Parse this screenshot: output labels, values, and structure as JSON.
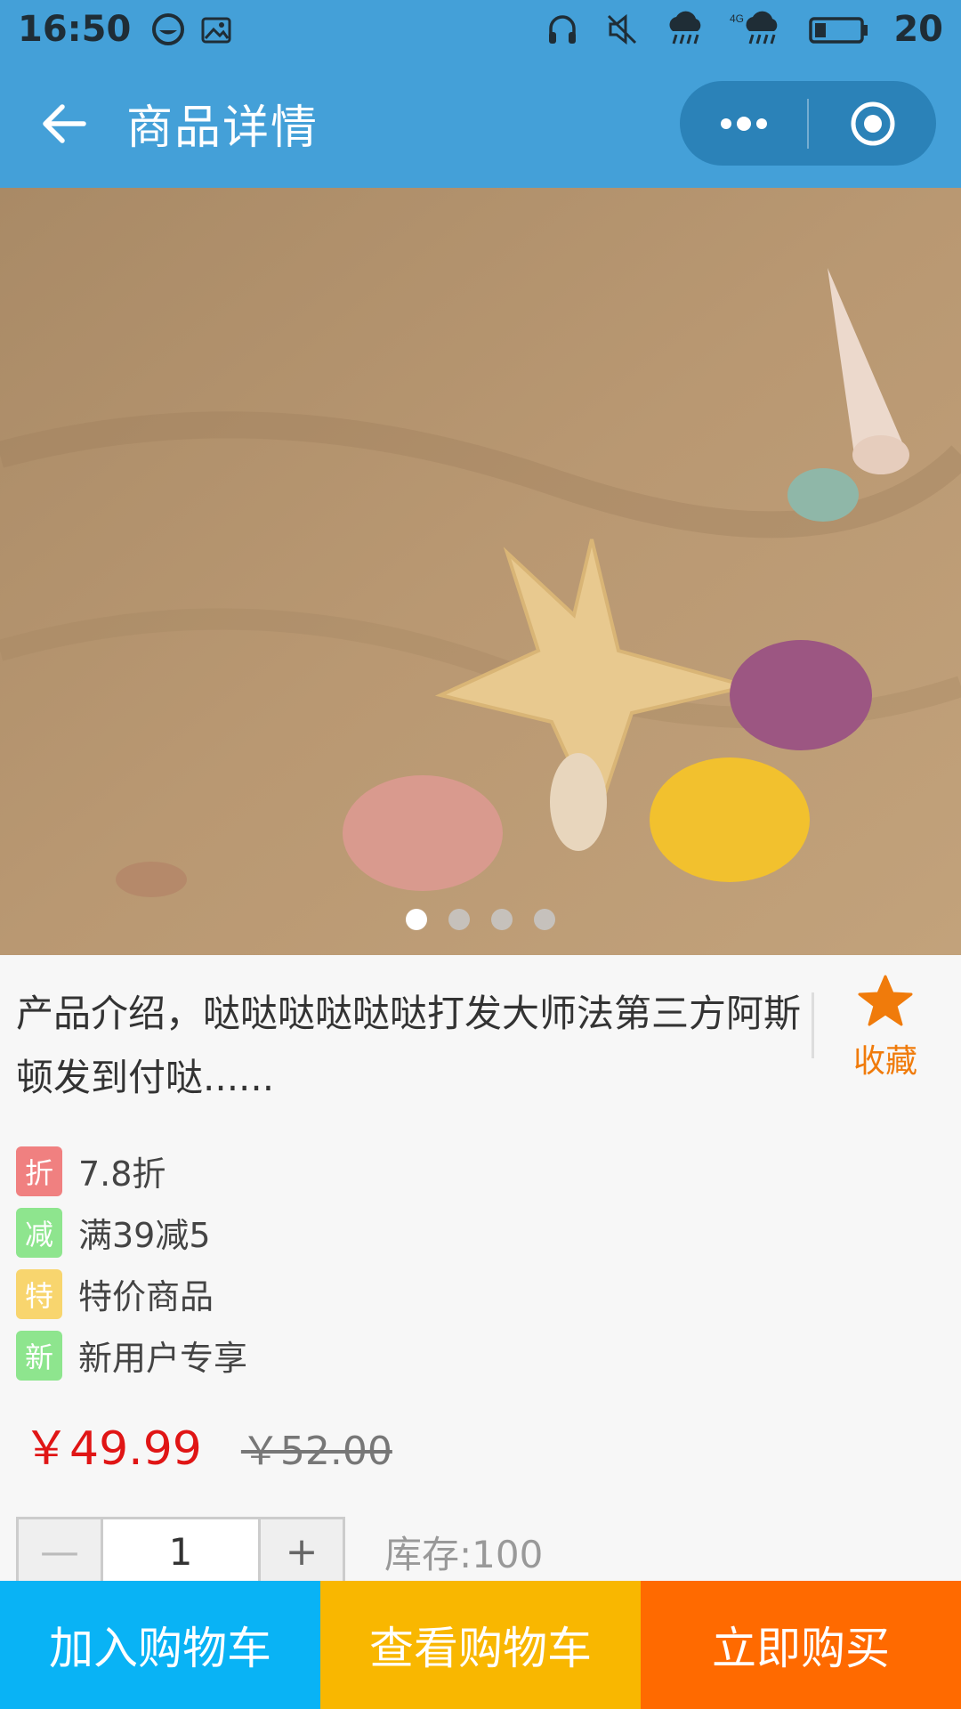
{
  "status_bar": {
    "time": "16:50",
    "battery": "20",
    "network": "4G",
    "icons": [
      "wechat-icon",
      "image-icon",
      "headset-icon",
      "mute-icon",
      "rain-icon",
      "rain-icon",
      "battery-icon"
    ]
  },
  "nav": {
    "title": "商品详情",
    "back_icon": "arrow-left-icon",
    "more_icon": "more-dots-icon",
    "close_icon": "target-icon"
  },
  "banner": {
    "slides": 4,
    "active_slide": 0
  },
  "product": {
    "description": "产品介绍，哒哒哒哒哒哒打发大师法第三方阿斯顿发到付哒......",
    "favorite_label": "收藏",
    "tags": [
      {
        "badge": "折",
        "text": "7.8折",
        "color": "#f08080"
      },
      {
        "badge": "减",
        "text": "满39减5",
        "color": "#8ee58e"
      },
      {
        "badge": "特",
        "text": "特价商品",
        "color": "#f8d56e"
      },
      {
        "badge": "新",
        "text": "新用户专享",
        "color": "#8ee58e"
      }
    ],
    "price": "￥49.99",
    "original_price": "￥52.00",
    "quantity": {
      "minus": "—",
      "value": "1",
      "plus": "+"
    },
    "stock": "库存:100"
  },
  "bottom_bar": {
    "add_to_cart": "加入购物车",
    "view_cart": "查看购物车",
    "buy_now": "立即购买",
    "colors": {
      "add_to_cart": "#09b3f5",
      "view_cart": "#f9b700",
      "buy_now": "#ff6a00"
    }
  },
  "colors": {
    "header": "#44a0d8",
    "price": "#e01515",
    "favorite": "#f07b0b"
  }
}
